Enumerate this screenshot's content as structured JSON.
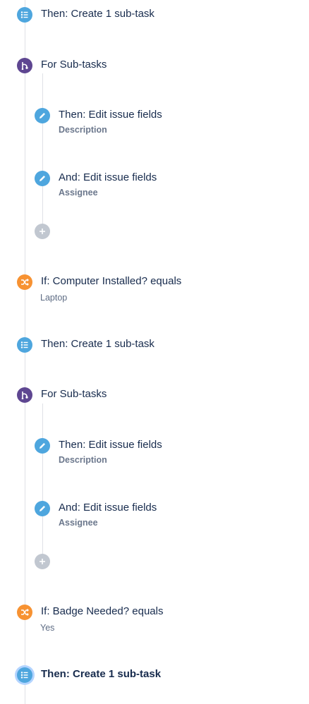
{
  "flow": {
    "n1": {
      "title": "Then: Create 1 sub-task"
    },
    "n2": {
      "title": "For Sub-tasks"
    },
    "n3": {
      "title": "Then: Edit issue fields",
      "sub": "Description"
    },
    "n4": {
      "title": "And: Edit issue fields",
      "sub": "Assignee"
    },
    "n6": {
      "title": "If: Computer Installed? equals",
      "sub": "Laptop"
    },
    "n7": {
      "title": "Then: Create 1 sub-task"
    },
    "n8": {
      "title": "For Sub-tasks"
    },
    "n9": {
      "title": "Then: Edit issue fields",
      "sub": "Description"
    },
    "n10": {
      "title": "And: Edit issue fields",
      "sub": "Assignee"
    },
    "n12": {
      "title": "If: Badge Needed? equals",
      "sub": "Yes"
    },
    "n13": {
      "title": "Then: Create 1 sub-task"
    }
  },
  "colors": {
    "action": "#4ea6de",
    "branch": "#5e4691",
    "condition": "#f79232",
    "add": "#c1c7d0",
    "rail": "#dfe1e6"
  },
  "icons": {
    "action": "list-icon",
    "branch": "branch-icon",
    "edit": "pencil-icon",
    "condition": "shuffle-icon",
    "add": "plus-icon"
  }
}
